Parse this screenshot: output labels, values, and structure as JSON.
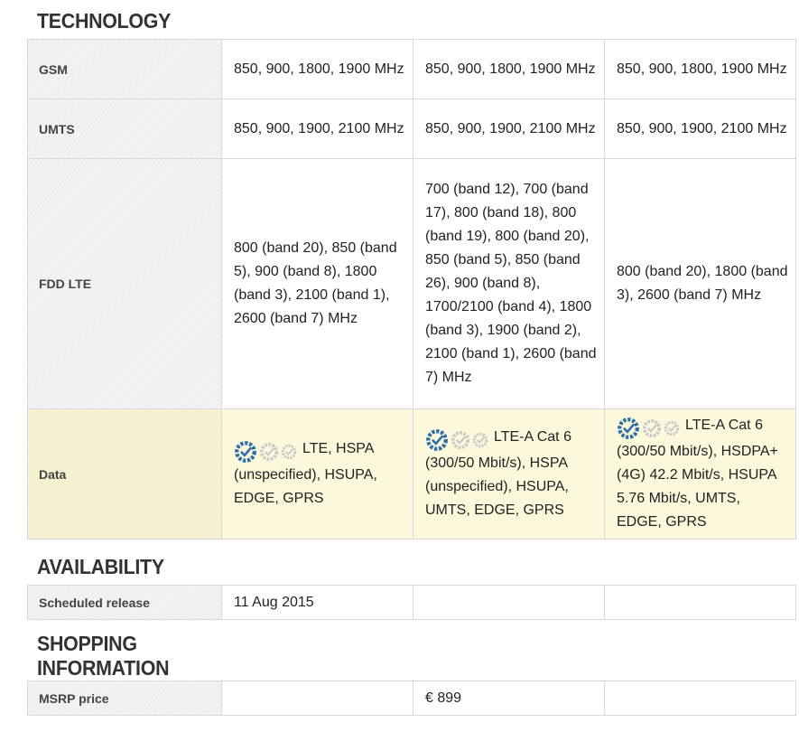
{
  "sections": {
    "technology": {
      "title": "TECHNOLOGY",
      "rows": [
        {
          "label": "GSM",
          "values": [
            "850, 900, 1800, 1900 MHz",
            "850, 900, 1800, 1900 MHz",
            "850, 900, 1800, 1900 MHz"
          ]
        },
        {
          "label": "UMTS",
          "values": [
            "850, 900, 1900, 2100 MHz",
            "850, 900, 1900, 2100 MHz",
            "850, 900, 1900, 2100 MHz"
          ]
        },
        {
          "label": "FDD LTE",
          "values": [
            "800 (band 20), 850 (band 5), 900 (band 8), 1800 (band 3), 2100 (band 1), 2600 (band 7) MHz",
            "700 (band 12), 700 (band 17), 800 (band 18), 800 (band 19), 800 (band 20), 850 (band 5), 850 (band 26), 900 (band 8), 1700/2100 (band 4), 1800 (band 3), 1900 (band 2), 2100 (band 1), 2600 (band 7) MHz",
            "800 (band 20), 1800 (band 3), 2600 (band 7) MHz"
          ]
        },
        {
          "label": "Data",
          "values": [
            "LTE, HSPA (unspecified), HSUPA, EDGE, GPRS",
            "LTE-A Cat 6 (300/50 Mbit/s), HSPA (unspecified), HSUPA, UMTS, EDGE, GPRS",
            "LTE-A Cat 6 (300/50 Mbit/s), HSDPA+ (4G) 42.2 Mbit/s, HSUPA 5.76 Mbit/s, UMTS, EDGE, GPRS"
          ],
          "icons": "speed-rating-icon"
        }
      ]
    },
    "availability": {
      "title": "AVAILABILITY",
      "rows": [
        {
          "label": "Scheduled release",
          "values": [
            "11 Aug 2015",
            "",
            ""
          ]
        }
      ]
    },
    "shopping": {
      "title_line1": "SHOPPING",
      "title_line2": "INFORMATION",
      "rows": [
        {
          "label": "MSRP price",
          "values": [
            "",
            "€ 899",
            ""
          ]
        }
      ]
    }
  },
  "colors": {
    "highlight_row": "#fbf8dc",
    "label_cell": "#f3f3f3",
    "border": "#d9d9d9",
    "speed_icon_active": "#2e6fa8",
    "speed_icon_inactive": "#c8c8c8"
  }
}
